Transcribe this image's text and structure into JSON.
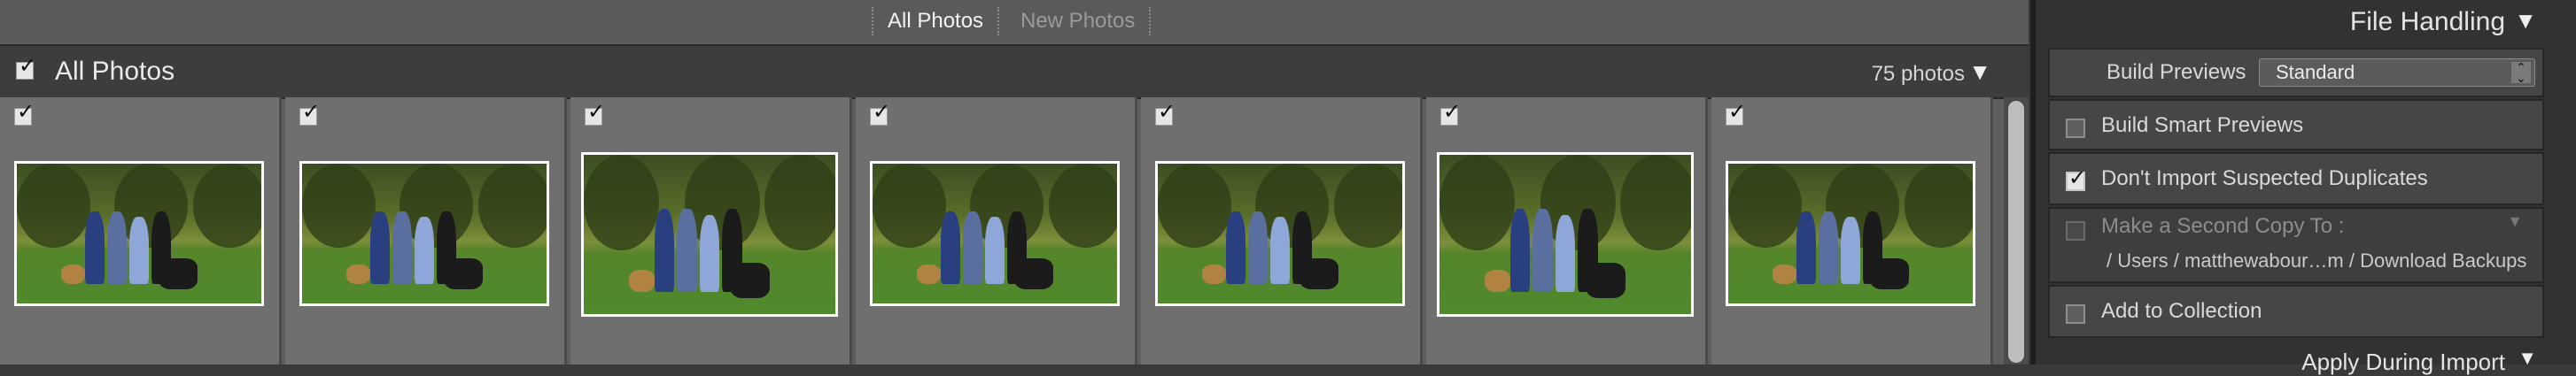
{
  "tabs": {
    "all_photos": "All Photos",
    "new_photos": "New Photos"
  },
  "header": {
    "title": "All Photos",
    "count": "75 photos",
    "count_arrow_icon": "triangle-down-icon"
  },
  "thumbnails": [
    {
      "checked": true,
      "selected": false
    },
    {
      "checked": true,
      "selected": false
    },
    {
      "checked": true,
      "selected": true
    },
    {
      "checked": true,
      "selected": false
    },
    {
      "checked": true,
      "selected": false
    },
    {
      "checked": true,
      "selected": true
    },
    {
      "checked": true,
      "selected": false
    }
  ],
  "file_handling": {
    "title": "File Handling",
    "build_previews_label": "Build Previews",
    "build_previews_value": "Standard",
    "build_smart_previews": {
      "label": "Build Smart Previews",
      "checked": false
    },
    "dont_import_duplicates": {
      "label": "Don't Import Suspected Duplicates",
      "checked": true
    },
    "second_copy": {
      "label": "Make a Second Copy To :",
      "path": "/ Users / matthewabour…m / Download Backups",
      "enabled": false
    },
    "add_to_collection": {
      "label": "Add to Collection",
      "checked": false
    }
  },
  "next_section": {
    "title": "Apply During Import"
  },
  "colors": {
    "panel_bg": "#323232",
    "grid_bg": "#5e5e5e",
    "cell_bg": "#6f6f6f"
  }
}
